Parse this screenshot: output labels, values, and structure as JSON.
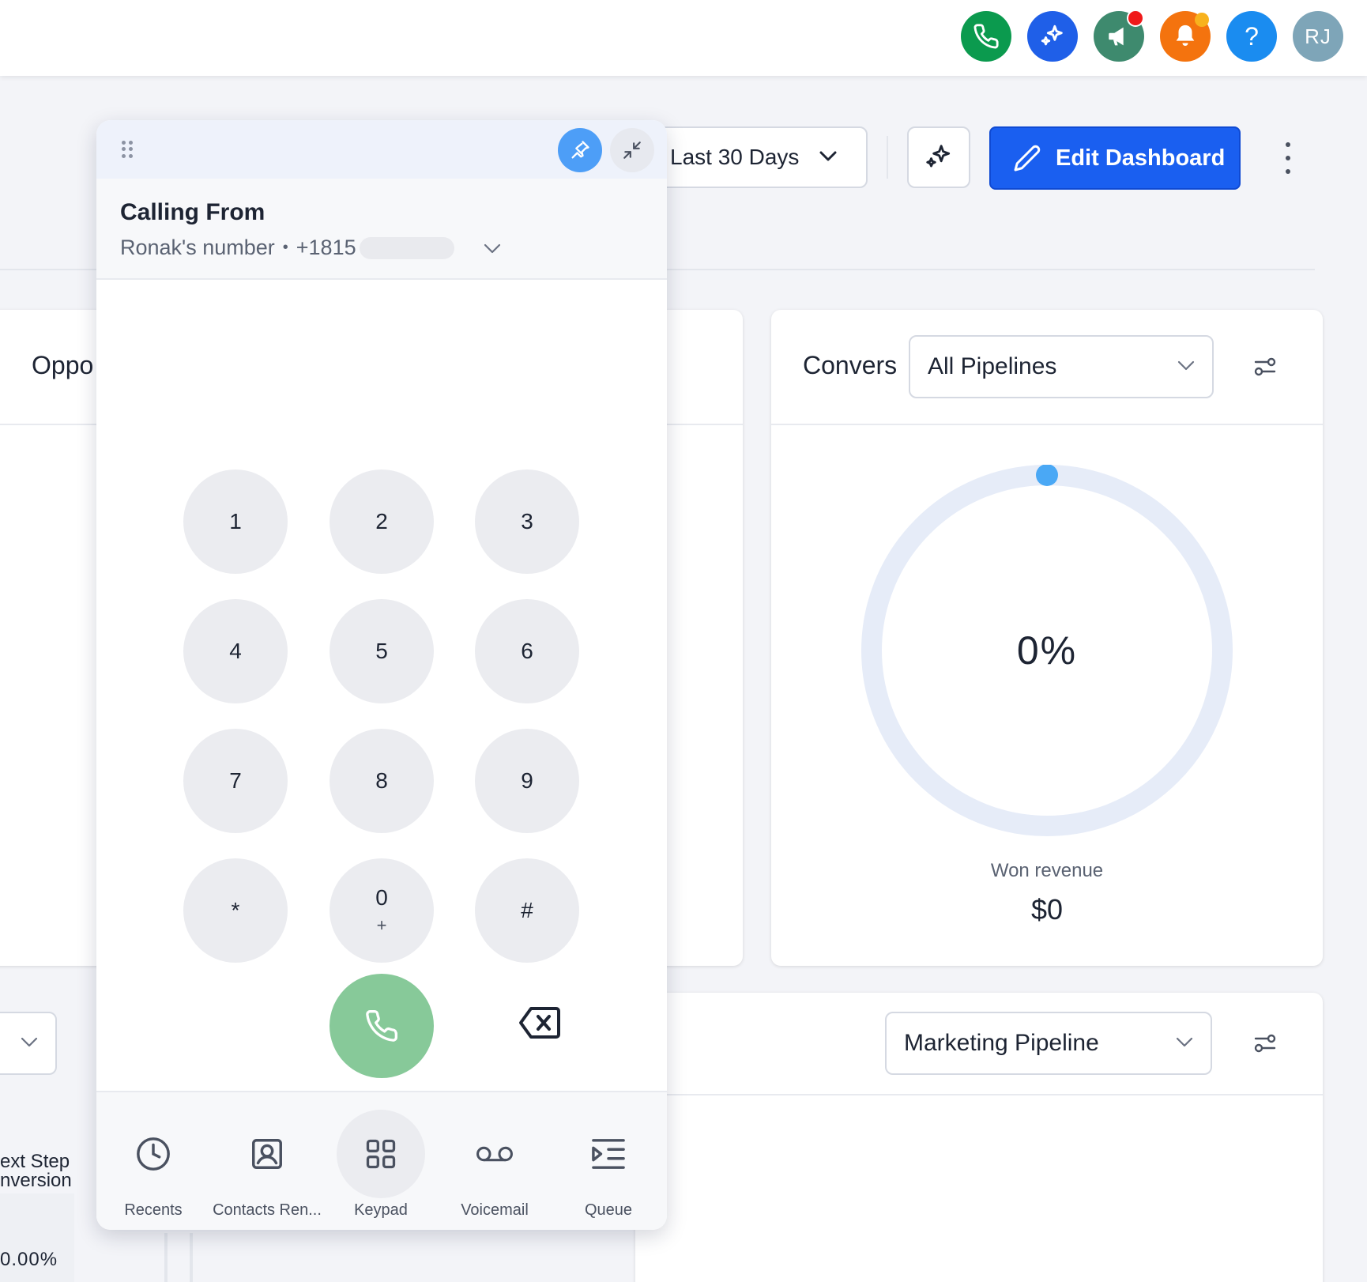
{
  "topbar": {
    "icons": [
      "phone-icon",
      "sparkle-icon",
      "megaphone-icon",
      "bell-icon",
      "help-icon"
    ],
    "help_label": "?",
    "avatar_initials": "RJ",
    "colors": {
      "phone": "#0b9a4e",
      "sparkle": "#1f5fe8",
      "megaphone": "#3e8a6e",
      "bell": "#f4730e",
      "help": "#1a8cf0",
      "avatar": "#7ea5b8"
    }
  },
  "toolbar": {
    "date_range": "Last 30 Days",
    "edit_label": "Edit Dashboard"
  },
  "cards": {
    "opportunities": {
      "title": "Oppo"
    },
    "conversion": {
      "title": "Convers",
      "pipeline_select": "All Pipelines",
      "percent": "0%",
      "won_label": "Won revenue",
      "won_value": "$0"
    },
    "bottom_right": {
      "pipeline_select": "Marketing Pipeline"
    },
    "bottom_left": {
      "label_line1": "ext Step",
      "label_line2": "nversion",
      "percent": "0.00%"
    }
  },
  "dialer": {
    "calling_from_title": "Calling From",
    "number_name": "Ronak's number",
    "separator": "•",
    "number_prefix": "+1815",
    "keys": [
      {
        "digit": "1",
        "sub": ""
      },
      {
        "digit": "2",
        "sub": ""
      },
      {
        "digit": "3",
        "sub": ""
      },
      {
        "digit": "4",
        "sub": ""
      },
      {
        "digit": "5",
        "sub": ""
      },
      {
        "digit": "6",
        "sub": ""
      },
      {
        "digit": "7",
        "sub": ""
      },
      {
        "digit": "8",
        "sub": ""
      },
      {
        "digit": "9",
        "sub": ""
      },
      {
        "digit": "*",
        "sub": ""
      },
      {
        "digit": "0",
        "sub": "+"
      },
      {
        "digit": "#",
        "sub": ""
      }
    ],
    "tabs": [
      {
        "label": "Recents",
        "icon": "clock-icon"
      },
      {
        "label": "Contacts Ren...",
        "icon": "contact-icon"
      },
      {
        "label": "Keypad",
        "icon": "keypad-icon",
        "active": true
      },
      {
        "label": "Voicemail",
        "icon": "voicemail-icon"
      },
      {
        "label": "Queue",
        "icon": "queue-icon"
      }
    ],
    "colors": {
      "call_button": "#87c999",
      "pin_button": "#4d9ef7"
    }
  }
}
